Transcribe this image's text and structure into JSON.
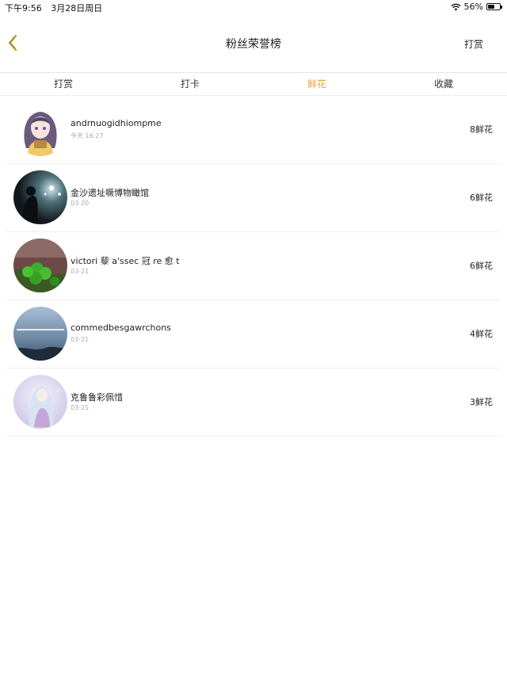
{
  "status_bar": {
    "time": "下午9:56",
    "date": "3月28日周日",
    "battery": "56%",
    "battery_level": 0.56
  },
  "nav": {
    "title": "粉丝荣誉榜",
    "right_action": "打赏"
  },
  "tabs": [
    {
      "label": "打赏",
      "active": false
    },
    {
      "label": "打卡",
      "active": false
    },
    {
      "label": "鲜花",
      "active": true
    },
    {
      "label": "收藏",
      "active": false
    }
  ],
  "colors": {
    "accent": "#e9a43a",
    "divider": "#eeeeee",
    "muted": "#aaaaaa"
  },
  "entries": [
    {
      "name": "andrnuogidhiompme",
      "date": "今天 16:27",
      "count": "8鲜花",
      "avatar": "anime-girl-avatar"
    },
    {
      "name": "金沙遗址噘博物瞰馆",
      "date": "03-20",
      "count": "6鲜花",
      "avatar": "night-lights-avatar"
    },
    {
      "name": "victori 藜 a'ssec 冠 re 愈 t",
      "date": "03-21",
      "count": "6鲜花",
      "avatar": "clover-avatar"
    },
    {
      "name": "commedbesgawrchons",
      "date": "03-21",
      "count": "4鲜花",
      "avatar": "sky-text-avatar"
    },
    {
      "name": "克鲁鲁彩佩惜",
      "date": "03-21",
      "count": "3鲜花",
      "avatar": "fairy-avatar"
    }
  ]
}
